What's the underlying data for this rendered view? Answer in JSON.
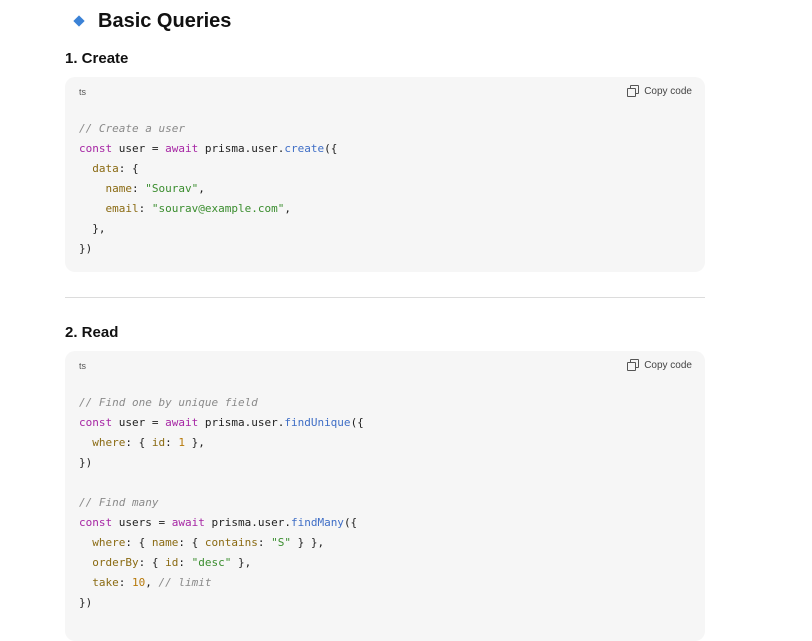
{
  "section": {
    "title": "Basic Queries"
  },
  "blocks": [
    {
      "heading": "1. Create",
      "lang": "ts",
      "copy_label": "Copy code",
      "code": {
        "l1": "// Create a user",
        "l2_kw1": "const",
        "l2_a": " user = ",
        "l2_kw2": "await",
        "l2_b": " prisma.user.",
        "l2_fn": "create",
        "l2_c": "({",
        "l3_prop": "data",
        "l3_a": ": {",
        "l4_prop": "name",
        "l4_a": ": ",
        "l4_str": "\"Sourav\"",
        "l4_b": ",",
        "l5_prop": "email",
        "l5_a": ": ",
        "l5_str": "\"sourav@example.com\"",
        "l5_b": ",",
        "l6": "},",
        "l7": "})"
      }
    },
    {
      "heading": "2. Read",
      "lang": "ts",
      "copy_label": "Copy code",
      "code": {
        "l1": "// Find one by unique field",
        "l2_kw1": "const",
        "l2_a": " user = ",
        "l2_kw2": "await",
        "l2_b": " prisma.user.",
        "l2_fn": "findUnique",
        "l2_c": "({",
        "l3_prop": "where",
        "l3_a": ": { ",
        "l3_prop2": "id",
        "l3_b": ": ",
        "l3_num": "1",
        "l3_c": " },",
        "l4": "})",
        "l6": "// Find many",
        "l7_kw1": "const",
        "l7_a": " users = ",
        "l7_kw2": "await",
        "l7_b": " prisma.user.",
        "l7_fn": "findMany",
        "l7_c": "({",
        "l8_prop": "where",
        "l8_a": ": { ",
        "l8_prop2": "name",
        "l8_b": ": { ",
        "l8_prop3": "contains",
        "l8_c": ": ",
        "l8_str": "\"S\"",
        "l8_d": " } },",
        "l9_prop": "orderBy",
        "l9_a": ": { ",
        "l9_prop2": "id",
        "l9_b": ": ",
        "l9_str": "\"desc\"",
        "l9_c": " },",
        "l10_prop": "take",
        "l10_a": ": ",
        "l10_num": "10",
        "l10_b": ", ",
        "l10_cm": "// limit",
        "l11": "})"
      }
    }
  ],
  "icons": {
    "section": "diamond-bullet-icon",
    "copy": "copy-icon"
  },
  "colors": {
    "accent": "#3b82d6",
    "keyword": "#a626a4",
    "function": "#3f6ec6",
    "string": "#3a8d2e",
    "comment": "#8a8a8a"
  }
}
